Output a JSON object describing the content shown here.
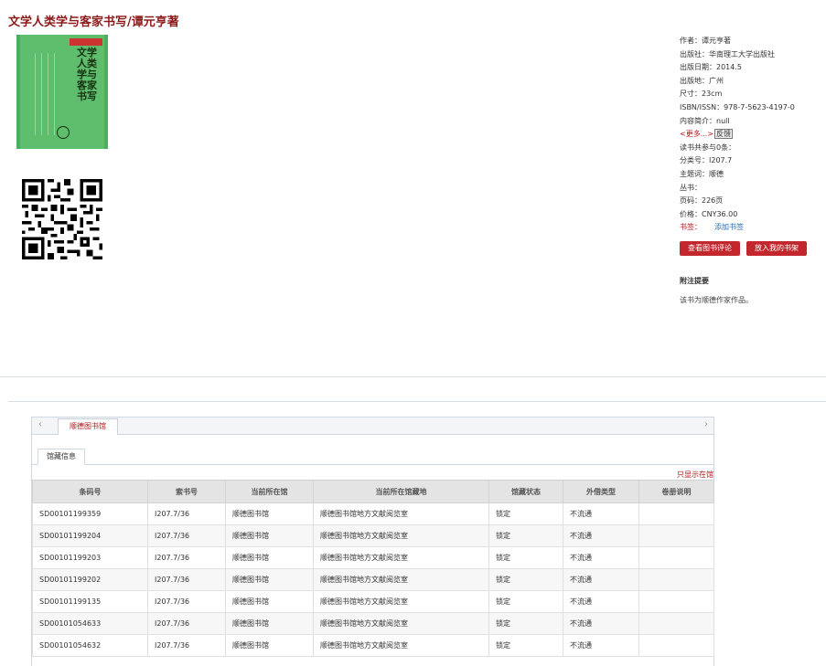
{
  "title": "文学人类学与客家书写/谭元亨著",
  "cover": {
    "title": "文学人类学与客家书写"
  },
  "meta": {
    "author": "作者：谭元亨著",
    "publisher": "出版社：华南理工大学出版社",
    "pub_date": "出版日期：2014.5",
    "pub_place": "出版地：广州",
    "size": "尺寸：23cm",
    "isbn": "ISBN/ISSN：978-7-5623-4197-0",
    "summary": "内容简介：null",
    "more_link": "<更多...>",
    "feedback": "反馈",
    "comments": "读书共参与0条：",
    "class_no": "分类号：I207.7",
    "subject": "主题词：顺德",
    "series": "丛书：",
    "pages": "页码：226页",
    "price": "价格：CNY36.00",
    "shelf_label": "书签：",
    "shelf_link": "添加书签"
  },
  "buttons": {
    "review": "查看图书评论",
    "add_shelf": "放入我的书架"
  },
  "notes": {
    "title": "附注提要",
    "text": "该书为顺德作家作品。"
  },
  "holdings": {
    "library_tab": "顺德图书馆",
    "holding_tab": "馆藏信息",
    "show_lib": "只显示在馆",
    "columns": [
      "条码号",
      "索书号",
      "当前所在馆",
      "当前所在馆藏地",
      "馆藏状态",
      "外借类型",
      "卷册说明"
    ],
    "rows": [
      [
        "SD00101199359",
        "I207.7/36",
        "顺德图书馆",
        "顺德图书馆地方文献阅览室",
        "锁定",
        "不流通",
        ""
      ],
      [
        "SD00101199204",
        "I207.7/36",
        "顺德图书馆",
        "顺德图书馆地方文献阅览室",
        "锁定",
        "不流通",
        ""
      ],
      [
        "SD00101199203",
        "I207.7/36",
        "顺德图书馆",
        "顺德图书馆地方文献阅览室",
        "锁定",
        "不流通",
        ""
      ],
      [
        "SD00101199202",
        "I207.7/36",
        "顺德图书馆",
        "顺德图书馆地方文献阅览室",
        "锁定",
        "不流通",
        ""
      ],
      [
        "SD00101199135",
        "I207.7/36",
        "顺德图书馆",
        "顺德图书馆地方文献阅览室",
        "锁定",
        "不流通",
        ""
      ],
      [
        "SD00101054633",
        "I207.7/36",
        "顺德图书馆",
        "顺德图书馆地方文献阅览室",
        "锁定",
        "不流通",
        ""
      ],
      [
        "SD00101054632",
        "I207.7/36",
        "顺德图书馆",
        "顺德图书馆地方文献阅览室",
        "锁定",
        "不流通",
        ""
      ]
    ]
  }
}
